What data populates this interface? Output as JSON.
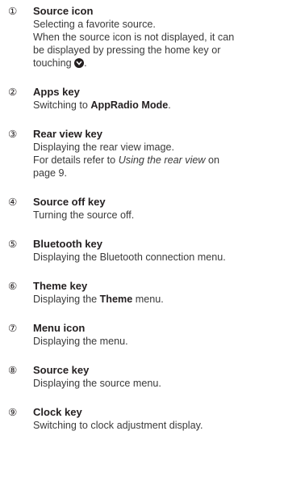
{
  "entries": [
    {
      "num": "①",
      "title": "Source icon",
      "lines": {
        "l1": "Selecting a favorite source.",
        "l2": "When the source icon is not displayed, it can",
        "l3": "be displayed by pressing the home key or",
        "l4a": "touching",
        "l4b": "."
      },
      "icon": "chevron-down-icon"
    },
    {
      "num": "②",
      "title": "Apps key",
      "lines": {
        "a": "Switching to ",
        "b": "AppRadio Mode",
        "c": "."
      }
    },
    {
      "num": "③",
      "title": "Rear view key",
      "lines": {
        "l1": "Displaying the rear view image.",
        "l2a": "For details refer to ",
        "l2b": "Using the rear view",
        "l2c": " on",
        "l3": "page 9."
      }
    },
    {
      "num": "④",
      "title": "Source off key",
      "lines": {
        "l1": "Turning the source off."
      }
    },
    {
      "num": "⑤",
      "title": "Bluetooth key",
      "lines": {
        "l1": "Displaying the Bluetooth connection menu."
      }
    },
    {
      "num": "⑥",
      "title": "Theme key",
      "lines": {
        "a": "Displaying the ",
        "b": "Theme",
        "c": " menu."
      }
    },
    {
      "num": "⑦",
      "title": "Menu icon",
      "lines": {
        "l1": "Displaying the menu."
      }
    },
    {
      "num": "⑧",
      "title": "Source key",
      "lines": {
        "l1": "Displaying the source menu."
      }
    },
    {
      "num": "⑨",
      "title": "Clock key",
      "lines": {
        "l1": "Switching to clock adjustment display."
      }
    }
  ]
}
